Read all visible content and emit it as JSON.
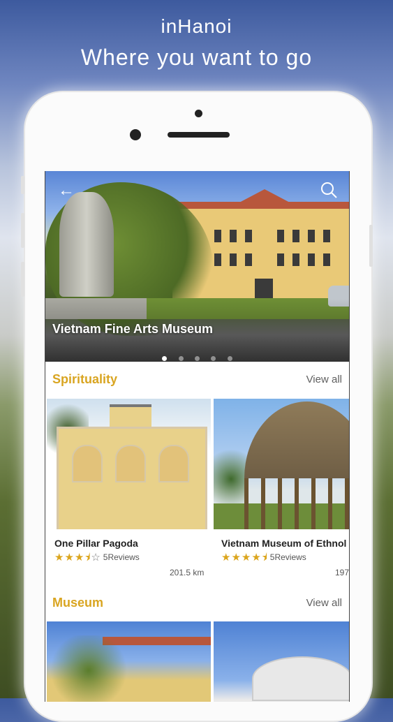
{
  "app": {
    "tagline_line1": "inHanoi",
    "tagline_line2": "Where you want to go"
  },
  "hero": {
    "title": "Vietnam Fine Arts Museum",
    "back_icon": "arrow-left-icon",
    "search_icon": "search-icon",
    "slide_count": 5,
    "active_slide": 1
  },
  "sections": [
    {
      "title": "Spirituality",
      "view_all": "View all",
      "items": [
        {
          "name": "One Pillar Pagoda",
          "rating": 3.5,
          "reviews": "5Reviews",
          "distance": "201.5 km"
        },
        {
          "name": "Vietnam Museum of Ethnol",
          "rating": 4.5,
          "reviews": "5Reviews",
          "distance": "197"
        }
      ]
    },
    {
      "title": "Museum",
      "view_all": "View all"
    }
  ],
  "colors": {
    "accent": "#d9a521",
    "star": "#dba51d",
    "text": "#222222",
    "muted": "#5f5f5f"
  }
}
